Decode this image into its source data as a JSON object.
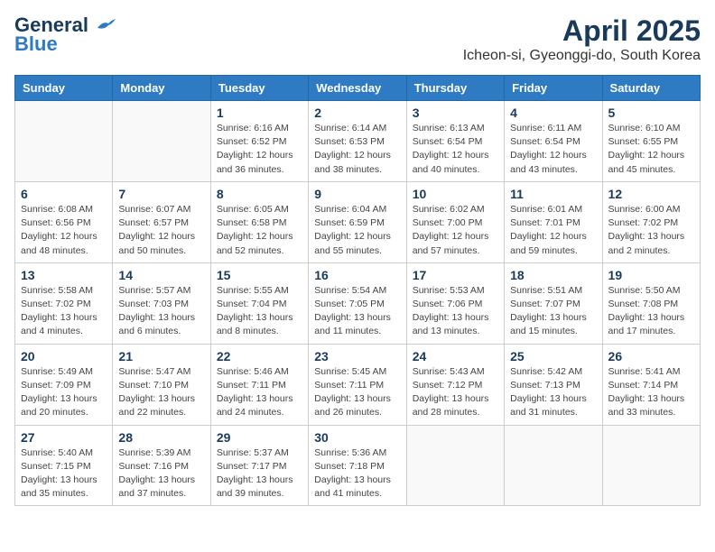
{
  "header": {
    "logo_line1": "General",
    "logo_line2": "Blue",
    "month_year": "April 2025",
    "location": "Icheon-si, Gyeonggi-do, South Korea"
  },
  "days_of_week": [
    "Sunday",
    "Monday",
    "Tuesday",
    "Wednesday",
    "Thursday",
    "Friday",
    "Saturday"
  ],
  "weeks": [
    [
      {
        "day": "",
        "info": ""
      },
      {
        "day": "",
        "info": ""
      },
      {
        "day": "1",
        "info": "Sunrise: 6:16 AM\nSunset: 6:52 PM\nDaylight: 12 hours and 36 minutes."
      },
      {
        "day": "2",
        "info": "Sunrise: 6:14 AM\nSunset: 6:53 PM\nDaylight: 12 hours and 38 minutes."
      },
      {
        "day": "3",
        "info": "Sunrise: 6:13 AM\nSunset: 6:54 PM\nDaylight: 12 hours and 40 minutes."
      },
      {
        "day": "4",
        "info": "Sunrise: 6:11 AM\nSunset: 6:54 PM\nDaylight: 12 hours and 43 minutes."
      },
      {
        "day": "5",
        "info": "Sunrise: 6:10 AM\nSunset: 6:55 PM\nDaylight: 12 hours and 45 minutes."
      }
    ],
    [
      {
        "day": "6",
        "info": "Sunrise: 6:08 AM\nSunset: 6:56 PM\nDaylight: 12 hours and 48 minutes."
      },
      {
        "day": "7",
        "info": "Sunrise: 6:07 AM\nSunset: 6:57 PM\nDaylight: 12 hours and 50 minutes."
      },
      {
        "day": "8",
        "info": "Sunrise: 6:05 AM\nSunset: 6:58 PM\nDaylight: 12 hours and 52 minutes."
      },
      {
        "day": "9",
        "info": "Sunrise: 6:04 AM\nSunset: 6:59 PM\nDaylight: 12 hours and 55 minutes."
      },
      {
        "day": "10",
        "info": "Sunrise: 6:02 AM\nSunset: 7:00 PM\nDaylight: 12 hours and 57 minutes."
      },
      {
        "day": "11",
        "info": "Sunrise: 6:01 AM\nSunset: 7:01 PM\nDaylight: 12 hours and 59 minutes."
      },
      {
        "day": "12",
        "info": "Sunrise: 6:00 AM\nSunset: 7:02 PM\nDaylight: 13 hours and 2 minutes."
      }
    ],
    [
      {
        "day": "13",
        "info": "Sunrise: 5:58 AM\nSunset: 7:02 PM\nDaylight: 13 hours and 4 minutes."
      },
      {
        "day": "14",
        "info": "Sunrise: 5:57 AM\nSunset: 7:03 PM\nDaylight: 13 hours and 6 minutes."
      },
      {
        "day": "15",
        "info": "Sunrise: 5:55 AM\nSunset: 7:04 PM\nDaylight: 13 hours and 8 minutes."
      },
      {
        "day": "16",
        "info": "Sunrise: 5:54 AM\nSunset: 7:05 PM\nDaylight: 13 hours and 11 minutes."
      },
      {
        "day": "17",
        "info": "Sunrise: 5:53 AM\nSunset: 7:06 PM\nDaylight: 13 hours and 13 minutes."
      },
      {
        "day": "18",
        "info": "Sunrise: 5:51 AM\nSunset: 7:07 PM\nDaylight: 13 hours and 15 minutes."
      },
      {
        "day": "19",
        "info": "Sunrise: 5:50 AM\nSunset: 7:08 PM\nDaylight: 13 hours and 17 minutes."
      }
    ],
    [
      {
        "day": "20",
        "info": "Sunrise: 5:49 AM\nSunset: 7:09 PM\nDaylight: 13 hours and 20 minutes."
      },
      {
        "day": "21",
        "info": "Sunrise: 5:47 AM\nSunset: 7:10 PM\nDaylight: 13 hours and 22 minutes."
      },
      {
        "day": "22",
        "info": "Sunrise: 5:46 AM\nSunset: 7:11 PM\nDaylight: 13 hours and 24 minutes."
      },
      {
        "day": "23",
        "info": "Sunrise: 5:45 AM\nSunset: 7:11 PM\nDaylight: 13 hours and 26 minutes."
      },
      {
        "day": "24",
        "info": "Sunrise: 5:43 AM\nSunset: 7:12 PM\nDaylight: 13 hours and 28 minutes."
      },
      {
        "day": "25",
        "info": "Sunrise: 5:42 AM\nSunset: 7:13 PM\nDaylight: 13 hours and 31 minutes."
      },
      {
        "day": "26",
        "info": "Sunrise: 5:41 AM\nSunset: 7:14 PM\nDaylight: 13 hours and 33 minutes."
      }
    ],
    [
      {
        "day": "27",
        "info": "Sunrise: 5:40 AM\nSunset: 7:15 PM\nDaylight: 13 hours and 35 minutes."
      },
      {
        "day": "28",
        "info": "Sunrise: 5:39 AM\nSunset: 7:16 PM\nDaylight: 13 hours and 37 minutes."
      },
      {
        "day": "29",
        "info": "Sunrise: 5:37 AM\nSunset: 7:17 PM\nDaylight: 13 hours and 39 minutes."
      },
      {
        "day": "30",
        "info": "Sunrise: 5:36 AM\nSunset: 7:18 PM\nDaylight: 13 hours and 41 minutes."
      },
      {
        "day": "",
        "info": ""
      },
      {
        "day": "",
        "info": ""
      },
      {
        "day": "",
        "info": ""
      }
    ]
  ]
}
